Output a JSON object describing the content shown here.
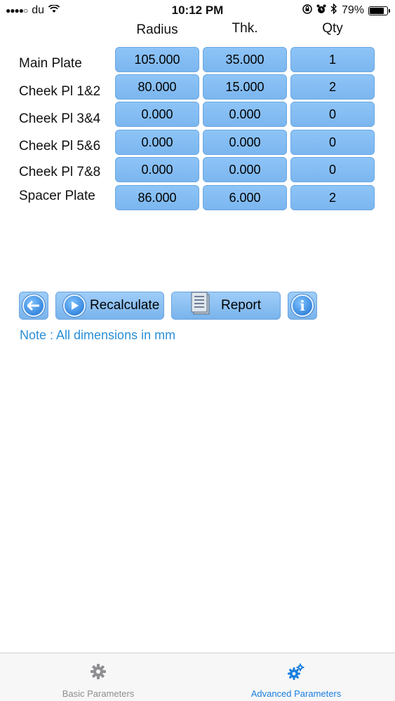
{
  "status_bar": {
    "signal": "●●●●○",
    "carrier": "du",
    "time": "10:12 PM",
    "battery_percent": "79%"
  },
  "table": {
    "columns": [
      "Radius",
      "Thk.",
      "Qty"
    ],
    "rows": [
      {
        "label": "Main Plate",
        "radius": "105.000",
        "thk": "35.000",
        "qty": "1"
      },
      {
        "label": "Cheek Pl 1&2",
        "radius": "80.000",
        "thk": "15.000",
        "qty": "2"
      },
      {
        "label": "Cheek Pl 3&4",
        "radius": "0.000",
        "thk": "0.000",
        "qty": "0"
      },
      {
        "label": "Cheek Pl 5&6",
        "radius": "0.000",
        "thk": "0.000",
        "qty": "0"
      },
      {
        "label": "Cheek Pl 7&8",
        "radius": "0.000",
        "thk": "0.000",
        "qty": "0"
      },
      {
        "label": "Spacer Plate",
        "radius": "86.000",
        "thk": "6.000",
        "qty": "2"
      }
    ]
  },
  "actions": {
    "recalculate_label": "Recalculate",
    "report_label": "Report"
  },
  "note": "Note : All dimensions in mm",
  "tabbar": {
    "tabs": [
      {
        "label": "Basic Parameters",
        "icon": "gear-icon",
        "active": false
      },
      {
        "label": "Advanced Parameters",
        "icon": "gears-icon",
        "active": true
      }
    ],
    "active_color": "#1a7ee0",
    "inactive_color": "#8e8e93"
  }
}
